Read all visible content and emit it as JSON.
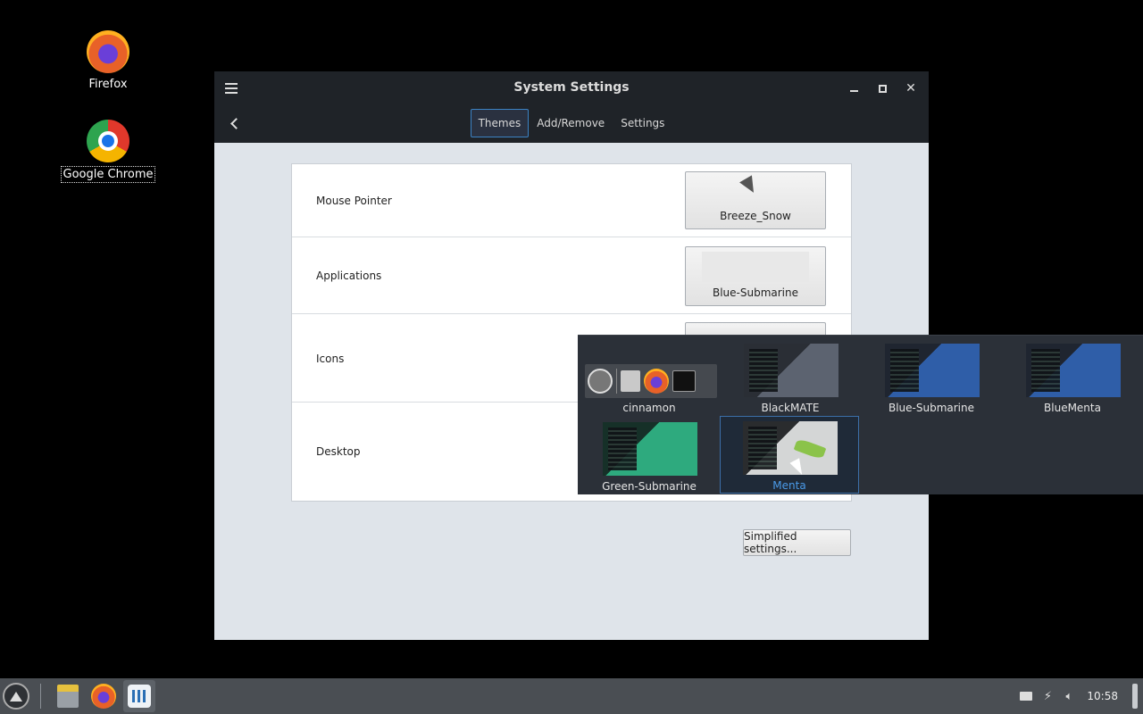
{
  "desktop": {
    "icons": [
      {
        "label": "Firefox",
        "icon": "firefox-icon"
      },
      {
        "label": "Google Chrome",
        "icon": "chrome-icon"
      }
    ]
  },
  "window": {
    "title": "System Settings",
    "tabs": [
      {
        "label": "Themes",
        "active": true
      },
      {
        "label": "Add/Remove",
        "active": false
      },
      {
        "label": "Settings",
        "active": false
      }
    ],
    "rows": [
      {
        "label": "Mouse Pointer",
        "value": "Breeze_Snow"
      },
      {
        "label": "Applications",
        "value": "Blue-Submarine"
      },
      {
        "label": "Icons",
        "value": ""
      },
      {
        "label": "Desktop",
        "value": ""
      }
    ],
    "simplified_label": "Simplified settings..."
  },
  "popup": {
    "themes": [
      {
        "name": "cinnamon",
        "selected": false
      },
      {
        "name": "BlackMATE",
        "selected": false
      },
      {
        "name": "Blue-Submarine",
        "selected": false
      },
      {
        "name": "BlueMenta",
        "selected": false
      },
      {
        "name": "Green-Submarine",
        "selected": false
      },
      {
        "name": "Menta",
        "selected": true
      }
    ]
  },
  "taskbar": {
    "clock": "10:58"
  },
  "colors": {
    "accent": "#3b82c4",
    "selected_text": "#4a9ae8"
  }
}
